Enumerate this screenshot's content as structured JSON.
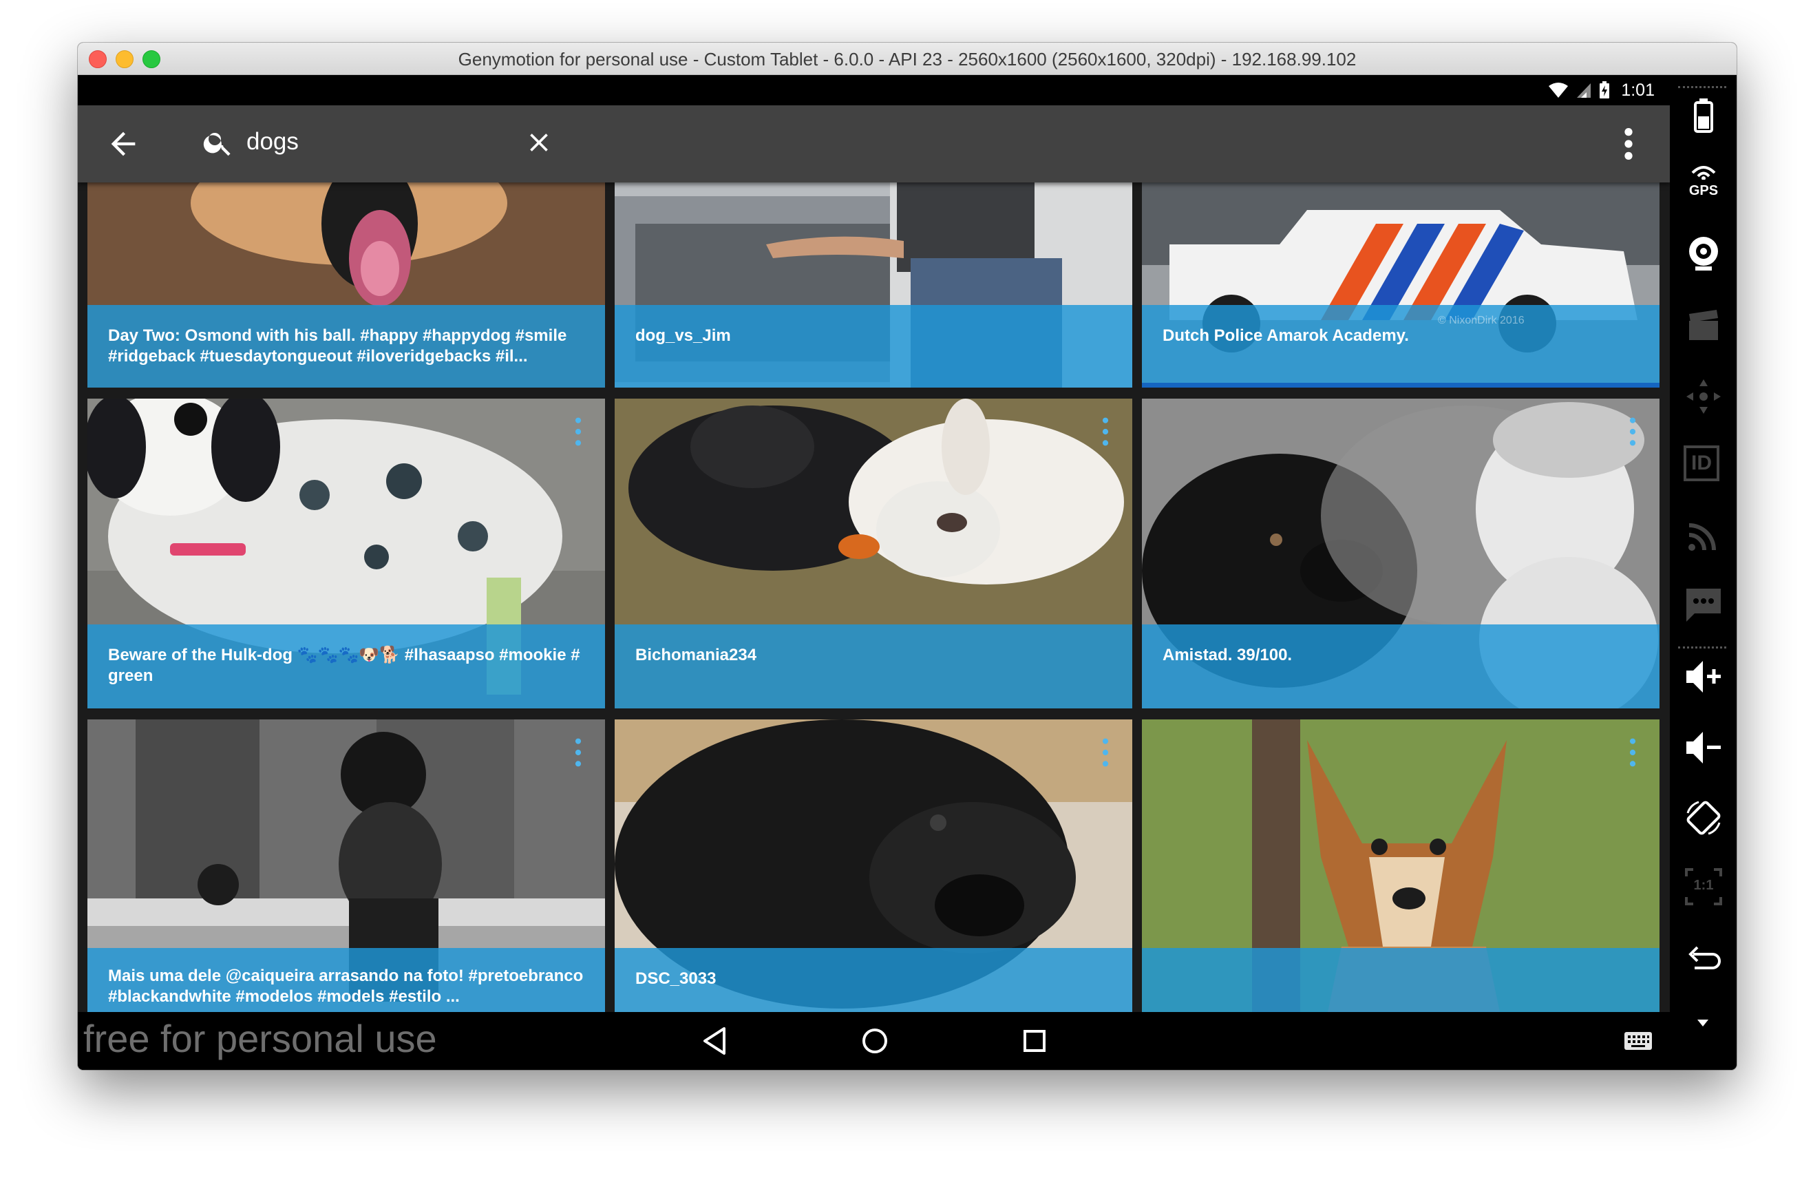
{
  "window": {
    "title": "Genymotion for personal use - Custom Tablet - 6.0.0 - API 23 - 2560x1600 (2560x1600, 320dpi) - 192.168.99.102"
  },
  "statusbar": {
    "time": "1:01",
    "icons": [
      "wifi-icon",
      "signal-icon",
      "battery-charging-icon"
    ]
  },
  "toolbar": {
    "query": "dogs",
    "icons": [
      "back-arrow-icon",
      "search-icon",
      "close-icon",
      "more-vert-icon"
    ]
  },
  "photos": [
    {
      "caption": "Day Two: Osmond with his ball.  #happy #happydog #smile #ridgeback #tuesdaytongueout #iloveridgebacks #il..."
    },
    {
      "caption": "dog_vs_Jim"
    },
    {
      "caption": "Dutch Police Amarok Academy.",
      "watermark": "© NixonDirk 2016"
    },
    {
      "caption": "Beware of the Hulk-dog 🐾🐾🐾🐶🐕 #lhasaapso #mookie # green"
    },
    {
      "caption": "Bichomania234"
    },
    {
      "caption": "Amistad. 39/100."
    },
    {
      "caption": "Mais uma dele @caiqueira arrasando na foto! #pretoebranco #blackandwhite #modelos #models #estilo ..."
    },
    {
      "caption": "DSC_3033"
    },
    {
      "caption": ""
    }
  ],
  "navbar": {
    "watermark": "free for personal use",
    "icons": [
      "nav-back-icon",
      "nav-home-icon",
      "nav-recents-icon",
      "keyboard-icon"
    ]
  },
  "sidebar": {
    "tools": [
      "battery-icon",
      "gps-icon",
      "webcam-icon",
      "capture-icon",
      "dpad-icon",
      "device-id-icon",
      "network-icon",
      "sms-icon",
      "volume-up-icon",
      "volume-down-icon",
      "rotate-icon",
      "pixel-perfect-icon",
      "back-icon",
      "collapse-icon"
    ],
    "gps_label": "GPS",
    "id_label": "ID",
    "scale_label": "1:1"
  },
  "colors": {
    "accent": "#1e96d7",
    "toolbar": "#424242",
    "statusbar": "#000000"
  }
}
